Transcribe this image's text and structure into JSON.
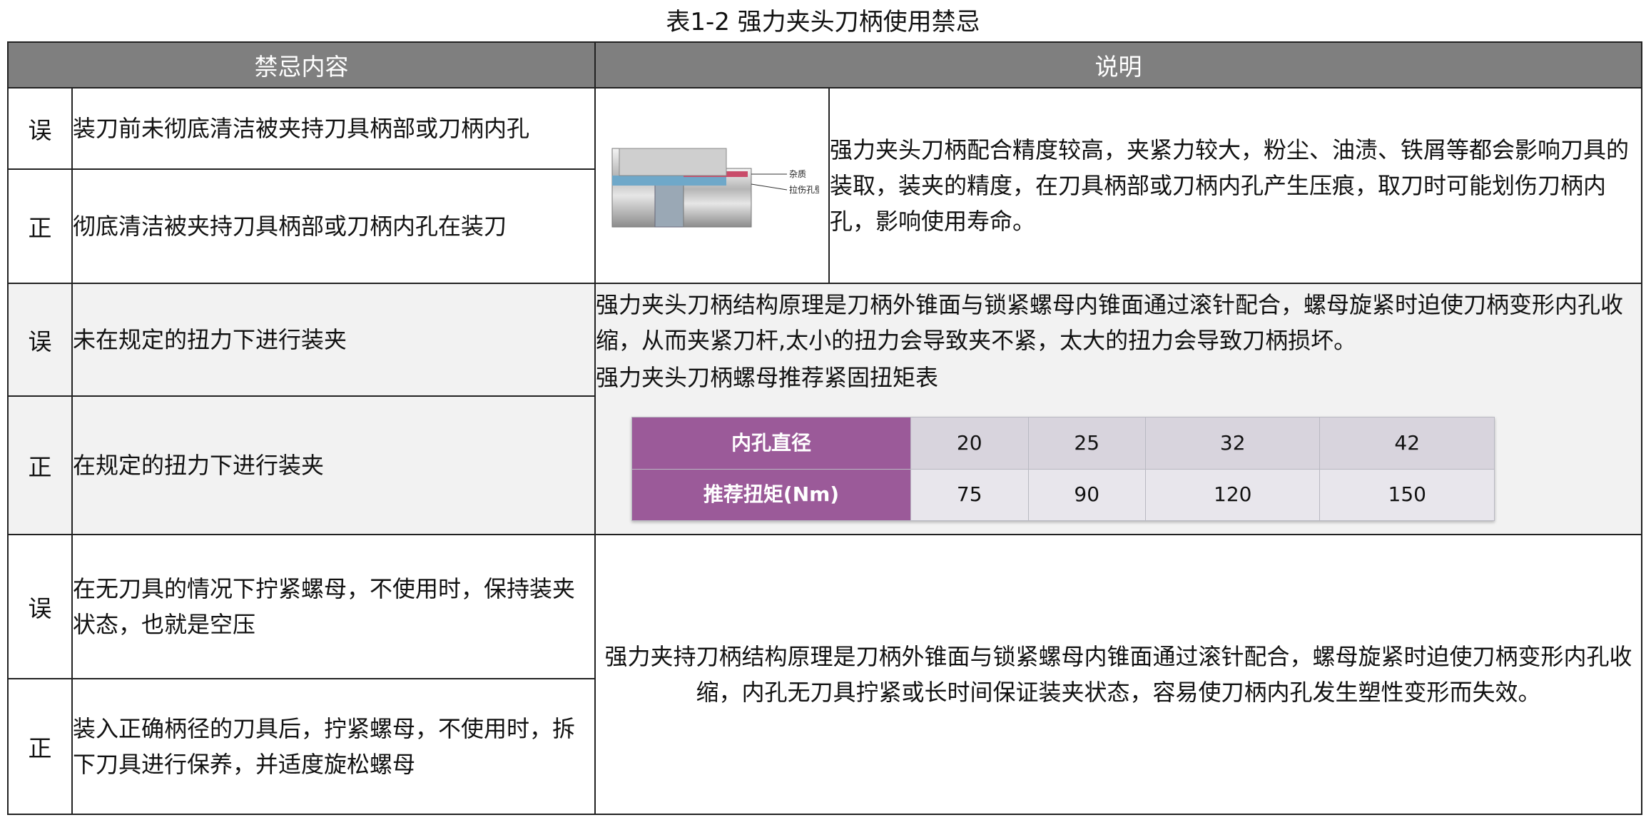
{
  "title": "表1-2 强力夹头刀柄使用禁忌",
  "headers": [
    "禁忌内容",
    "说明"
  ],
  "marks": {
    "wrong": "误",
    "right": "正"
  },
  "rows": [
    {
      "wrong": "装刀前未彻底清洁被夹持刀具柄部或刀柄内孔",
      "right": "彻底清洁被夹持刀具柄部或刀柄内孔在装刀",
      "image_labels": [
        "杂质",
        "拉伤孔壁"
      ],
      "description": "强力夹头刀柄配合精度较高，夹紧力较大，粉尘、油渍、铁屑等都会影响刀具的装取，装夹的精度，在刀具柄部或刀柄内孔产生压痕，取刀时可能划伤刀柄内孔，影响使用寿命。"
    },
    {
      "wrong": "未在规定的扭力下进行装夹",
      "right": "在规定的扭力下进行装夹",
      "description": "强力夹头刀柄结构原理是刀柄外锥面与锁紧螺母内锥面通过滚针配合，螺母旋紧时迫使刀柄变形内孔收缩，从而夹紧刀杆,太小的扭力会导致夹不紧，太大的扭力会导致刀柄损坏。",
      "table_caption": "强力夹头刀柄螺母推荐紧固扭矩表",
      "torque_table": {
        "row1_label": "内孔直径",
        "row1_values": [
          "20",
          "25",
          "32",
          "42"
        ],
        "row2_label": "推荐扭矩(Nm)",
        "row2_values": [
          "75",
          "90",
          "120",
          "150"
        ]
      }
    },
    {
      "wrong": "在无刀具的情况下拧紧螺母，不使用时，保持装夹状态，也就是空压",
      "right": "装入正确柄径的刀具后，拧紧螺母，不使用时，拆下刀具进行保养，并适度旋松螺母",
      "description": "强力夹持刀柄结构原理是刀柄外锥面与锁紧螺母内锥面通过滚针配合，螺母旋紧时迫使刀柄变形内孔收缩，内孔无刀具拧紧或长时间保证装夹状态，容易使刀柄内孔发生塑性变形而失效。"
    }
  ],
  "colors": {
    "header_bg": "#7f7f7f",
    "row_grey": "#f2f2f2",
    "torque_header": "#9b5a99"
  }
}
